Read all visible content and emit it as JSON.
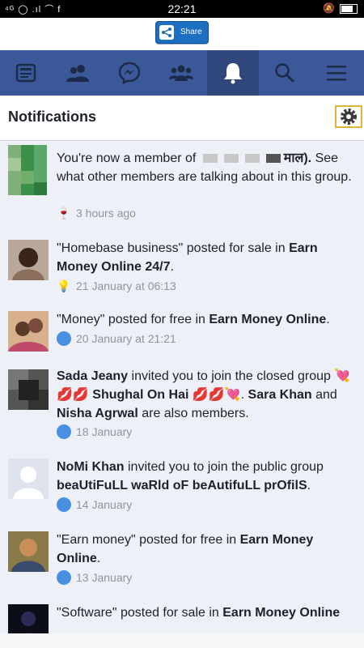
{
  "status": {
    "time": "22:21",
    "left_icons": "⁴ᴳ ◯ .ıl ⌒ f",
    "right_icons": "🔕"
  },
  "share": {
    "label": "Share"
  },
  "header": {
    "title": "Notifications"
  },
  "notifications": [
    {
      "pre": "You're now a member of ",
      "b1": "",
      "mid": "माल).",
      "tail": " See what other members are talking about in this group.",
      "time": "3 hours ago"
    },
    {
      "pre": "\"Homebase business\" posted for sale in ",
      "b1": "Earn Money Online 24/7",
      "tail": ".",
      "time": "21 January at 06:13"
    },
    {
      "pre": "\"Money\" posted for free in ",
      "b1": "Earn Money Online",
      "tail": ".",
      "time": "20 January at 21:21"
    },
    {
      "b0": "Sada Jeany",
      "pre": " invited you to join the closed group ",
      "b1": "💘💋💋 Shughal On Hai 💋💋💘",
      "mid": ". ",
      "b2": "Sara Khan",
      "mid2": " and ",
      "b3": "Nisha Agrwal",
      "tail": " are also members.",
      "time": "18 January"
    },
    {
      "b0": "NoMi Khan",
      "pre": " invited you to join the public group ",
      "b1": "beaUtiFuLL waRld oF beAutifuLL prOfilS",
      "tail": ".",
      "time": "14 January"
    },
    {
      "pre": "\"Earn money\" posted for free in ",
      "b1": "Earn Money Online",
      "tail": ".",
      "time": "13 January"
    },
    {
      "pre": "\"Software\" posted for sale in ",
      "b1": "Earn Money Online",
      "tail": "",
      "time": ""
    }
  ],
  "colors": {
    "nav": "#3b5998",
    "nav_active": "#2f477a",
    "row_bg": "#edf0f6"
  }
}
